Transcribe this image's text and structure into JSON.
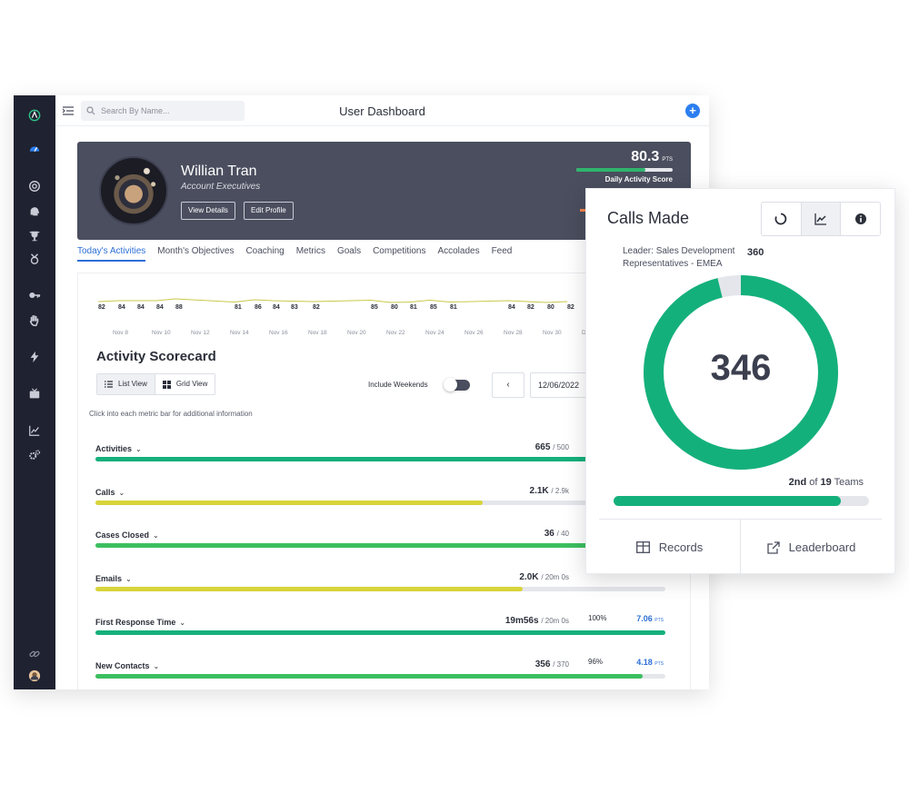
{
  "header": {
    "title": "User Dashboard",
    "search_placeholder": "Search By Name..."
  },
  "profile": {
    "name": "Willian Tran",
    "role": "Account Executives",
    "view_details": "View Details",
    "edit_profile": "Edit Profile",
    "score": "80.3",
    "score_unit": "PTS",
    "score_label": "Daily Activity Score",
    "score_fraction": 0.72
  },
  "tabs": [
    "Today's Activities",
    "Month's Objectives",
    "Coaching",
    "Metrics",
    "Goals",
    "Competitions",
    "Accolades",
    "Feed"
  ],
  "sparkline": {
    "values": [
      "82",
      "84",
      "84",
      "84",
      "88",
      "81",
      "86",
      "84",
      "83",
      "82",
      "85",
      "80",
      "81",
      "85",
      "81",
      "84",
      "82",
      "80",
      "82"
    ],
    "dates": [
      "Nov 8",
      "Nov 10",
      "Nov 12",
      "Nov 14",
      "Nov 16",
      "Nov 18",
      "Nov 20",
      "Nov 22",
      "Nov 24",
      "Nov 26",
      "Nov 28",
      "Nov 30",
      "D"
    ]
  },
  "scorecard": {
    "title": "Activity Scorecard",
    "list_view": "List View",
    "grid_view": "Grid View",
    "include_weekends": "Include Weekends",
    "prev": "‹",
    "date": "12/06/2022",
    "hint": "Click into each metric bar for additional information"
  },
  "metrics": [
    {
      "name": "Activities",
      "value": "665",
      "target": "/ 500",
      "pct": "",
      "pts": "",
      "pts_unit": "",
      "fill": 1.0,
      "color": "#14b07c"
    },
    {
      "name": "Calls",
      "value": "2.1K",
      "target": "/ 2.9k",
      "pct": "",
      "pts": "",
      "pts_unit": "",
      "fill": 0.68,
      "color": "#d8d43a"
    },
    {
      "name": "Cases Closed",
      "value": "36",
      "target": "/ 40",
      "pct": "",
      "pts": "",
      "pts_unit": "",
      "fill": 0.9,
      "color": "#3cbf60"
    },
    {
      "name": "Emails",
      "value": "2.0K",
      "target": "/ 20m 0s",
      "pct": "",
      "pts": "",
      "pts_unit": "",
      "fill": 0.75,
      "color": "#d8d43a"
    },
    {
      "name": "First Response Time",
      "value": "19m56s",
      "target": "/ 20m 0s",
      "pct": "100%",
      "pts": "7.06",
      "pts_unit": "PTS",
      "fill": 1.0,
      "color": "#14b07c"
    },
    {
      "name": "New Contacts",
      "value": "356",
      "target": "/ 370",
      "pct": "96%",
      "pts": "4.18",
      "pts_unit": "PTS",
      "fill": 0.96,
      "color": "#3cbf60"
    }
  ],
  "card": {
    "title": "Calls Made",
    "leader": "Leader: Sales Development Representatives - EMEA",
    "leader_value": "360",
    "value": "346",
    "max": 360,
    "rank_place": "2nd",
    "rank_of": "of",
    "rank_total": "19",
    "rank_suffix": "Teams",
    "rank_fraction": 0.89,
    "records": "Records",
    "leaderboard": "Leaderboard"
  },
  "colors": {
    "accent": "#2d6fd6",
    "green": "#14b07c",
    "sidebar": "#1f2230"
  },
  "sidebar_icons": [
    "logo-icon",
    "gauge-icon",
    "target-icon",
    "brain-icon",
    "trophy-icon",
    "medal-icon",
    "key-icon",
    "hand-icon",
    "bolt-icon",
    "tv-icon",
    "chart-icon",
    "gears-icon",
    "link-icon",
    "user-avatar-icon"
  ]
}
